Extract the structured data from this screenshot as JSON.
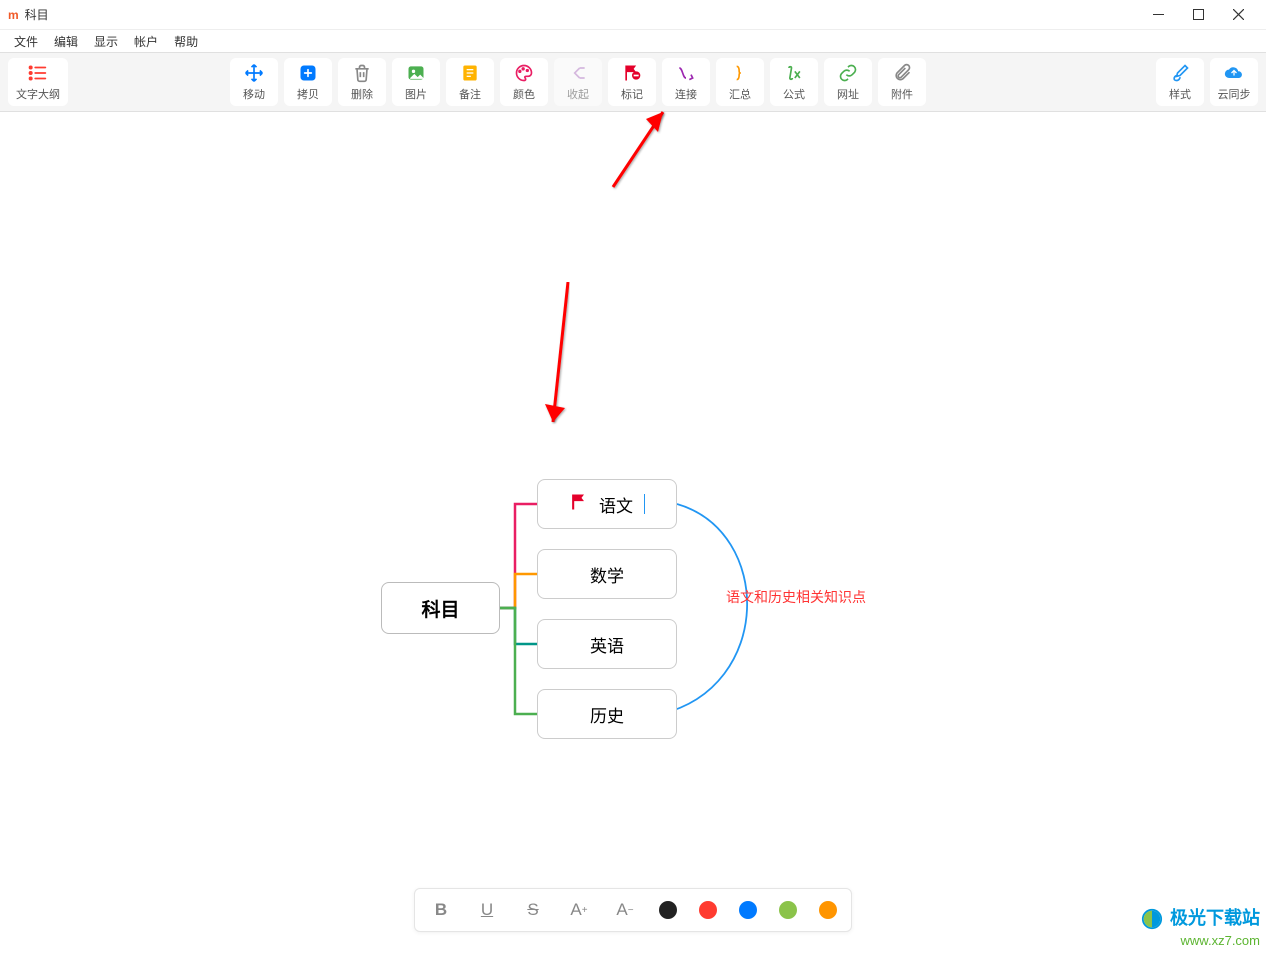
{
  "window": {
    "app_icon_text": "m",
    "title": "科目"
  },
  "menu": {
    "file": "文件",
    "edit": "编辑",
    "display": "显示",
    "account": "帐户",
    "help": "帮助"
  },
  "toolbar": {
    "outline": "文字大纲",
    "move": "移动",
    "copy": "拷贝",
    "delete": "删除",
    "image": "图片",
    "note": "备注",
    "color": "颜色",
    "collapse": "收起",
    "mark": "标记",
    "connect": "连接",
    "summary": "汇总",
    "formula": "公式",
    "url": "网址",
    "attachment": "附件",
    "style": "样式",
    "sync": "云同步"
  },
  "mindmap": {
    "root": "科目",
    "children": [
      "语文",
      "数学",
      "英语",
      "历史"
    ],
    "relation_label": "语文和历史相关知识点"
  },
  "format": {
    "bold": "B",
    "underline": "U",
    "strike": "S",
    "inc": "A",
    "dec": "A",
    "colors": [
      "#222222",
      "#ff3b30",
      "#007aff",
      "#8bc34a",
      "#ff9500"
    ]
  },
  "watermark": {
    "line1": "极光下载站",
    "line2": "www.xz7.com"
  }
}
